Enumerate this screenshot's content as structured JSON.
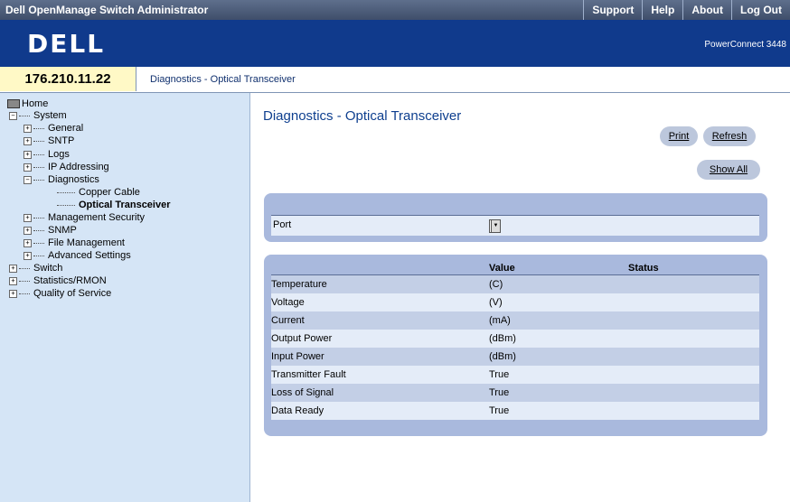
{
  "header": {
    "app_title": "Dell OpenManage Switch Administrator",
    "links": [
      "Support",
      "Help",
      "About",
      "Log Out"
    ]
  },
  "banner": {
    "logo": "DELL",
    "product": "PowerConnect 3448"
  },
  "address_bar": {
    "ip": "176.210.11.22",
    "breadcrumb": "Diagnostics - Optical Transceiver"
  },
  "sidebar": {
    "items": [
      {
        "label": "Home"
      },
      {
        "label": "System",
        "expander": "−"
      },
      {
        "label": "General",
        "expander": "+"
      },
      {
        "label": "SNTP",
        "expander": "+"
      },
      {
        "label": "Logs",
        "expander": "+"
      },
      {
        "label": "IP Addressing",
        "expander": "+"
      },
      {
        "label": "Diagnostics",
        "expander": "−"
      },
      {
        "label": "Copper Cable"
      },
      {
        "label": "Optical Transceiver",
        "selected": true
      },
      {
        "label": "Management Security",
        "expander": "+"
      },
      {
        "label": "SNMP",
        "expander": "+"
      },
      {
        "label": "File Management",
        "expander": "+"
      },
      {
        "label": "Advanced Settings",
        "expander": "+"
      },
      {
        "label": "Switch",
        "expander": "+"
      },
      {
        "label": "Statistics/RMON",
        "expander": "+"
      },
      {
        "label": "Quality of Service",
        "expander": "+"
      }
    ]
  },
  "main": {
    "title": "Diagnostics - Optical Transceiver",
    "buttons": {
      "print": "Print",
      "refresh": "Refresh",
      "show_all": "Show All"
    },
    "port_label": "Port",
    "table": {
      "headers": [
        "",
        "Value",
        "Status"
      ],
      "rows": [
        {
          "name": "Temperature",
          "value": "(C)",
          "status": ""
        },
        {
          "name": "Voltage",
          "value": "(V)",
          "status": ""
        },
        {
          "name": "Current",
          "value": "(mA)",
          "status": ""
        },
        {
          "name": "Output Power",
          "value": "(dBm)",
          "status": ""
        },
        {
          "name": "Input Power",
          "value": "(dBm)",
          "status": ""
        },
        {
          "name": "Transmitter Fault",
          "value": "True",
          "status": ""
        },
        {
          "name": "Loss of Signal",
          "value": "True",
          "status": ""
        },
        {
          "name": "Data Ready",
          "value": "True",
          "status": ""
        }
      ]
    }
  }
}
